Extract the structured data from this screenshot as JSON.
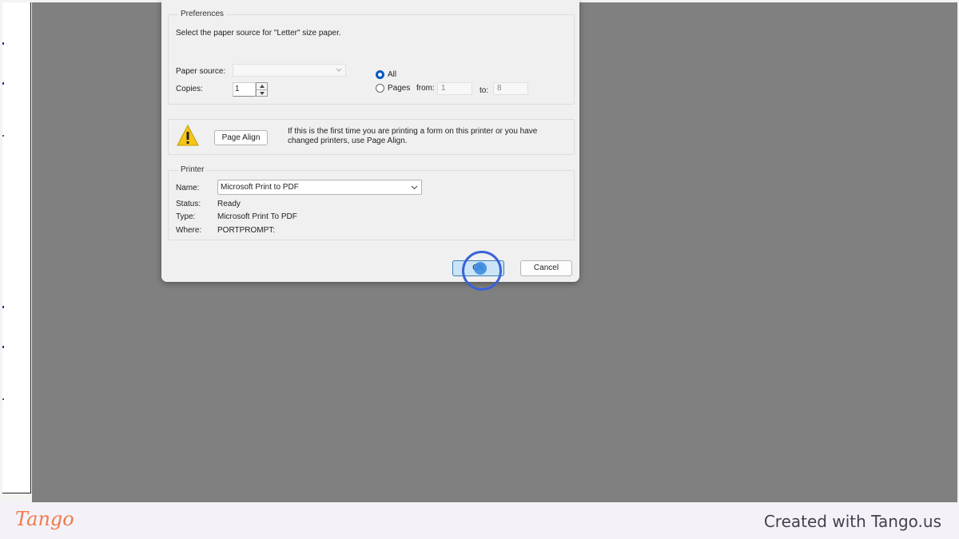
{
  "preferences": {
    "legend": "Preferences",
    "instruction": "Select the paper source for \"Letter\" size paper.",
    "paper_source_label": "Paper source:",
    "paper_source_value": "",
    "copies_label": "Copies:",
    "copies_value": "1",
    "range_all_label": "All",
    "range_pages_label": "Pages",
    "from_label": "from:",
    "from_value": "1",
    "to_label": "to:",
    "to_value": "8",
    "selected_range": "All"
  },
  "page_align": {
    "button_label": "Page Align",
    "message": "If this is the first time you are printing a form on this printer or you have changed printers, use Page Align."
  },
  "printer": {
    "legend": "Printer",
    "name_label": "Name:",
    "name_value": "Microsoft Print to PDF",
    "status_label": "Status:",
    "status_value": "Ready",
    "type_label": "Type:",
    "type_value": "Microsoft Print To PDF",
    "where_label": "Where:",
    "where_value": "PORTPROMPT:"
  },
  "buttons": {
    "ok_label": "OK",
    "cancel_label": "Cancel"
  },
  "footer": {
    "logo_text": "Tango",
    "credit_text": "Created with Tango.us"
  },
  "colors": {
    "accent": "#0058c4",
    "click_ring": "#3b63d8",
    "tango_brand": "#ef7a4a",
    "warning": "#f5c518"
  },
  "icons": {
    "warning": "warning-triangle-icon",
    "dropdown": "chevron-down-icon",
    "spin_up": "triangle-up-icon",
    "spin_down": "triangle-down-icon"
  }
}
